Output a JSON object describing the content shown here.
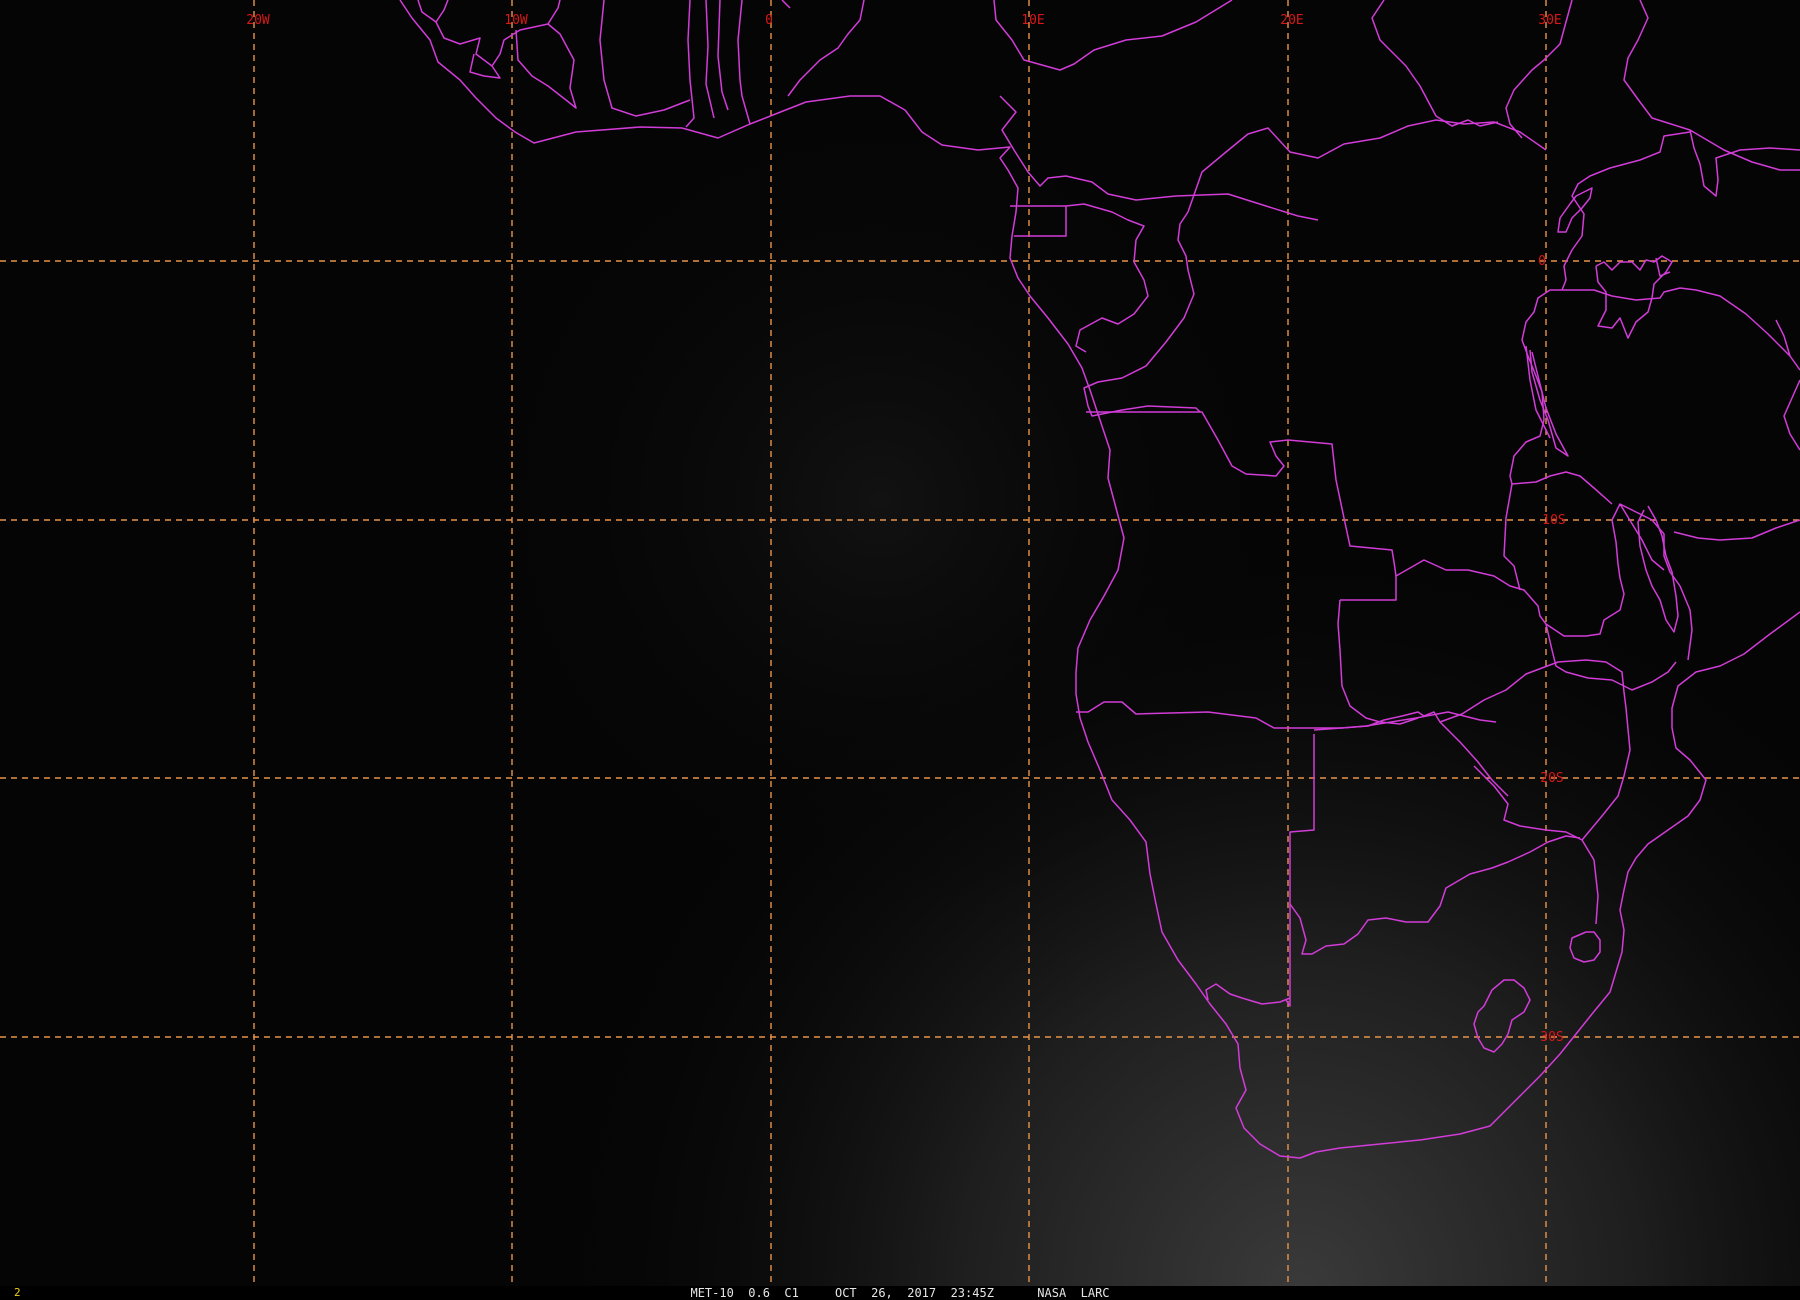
{
  "imagery": {
    "caption": "MET-10  0.6  C1     OCT  26,  2017  23:45Z      NASA  LARC",
    "frame_number": "2"
  },
  "graticule": {
    "longitude_labels": [
      "20W",
      "10W",
      "0",
      "10E",
      "20E",
      "30E"
    ],
    "latitude_labels": [
      "0",
      "10S",
      "20S",
      "30S"
    ]
  },
  "colors": {
    "background": "#050505",
    "grid_lines": "#e8944a",
    "grid_labels": "#d81818",
    "borders": "#d23cd8",
    "frame_number": "#f0d020",
    "caption": "#e6e6e6"
  }
}
